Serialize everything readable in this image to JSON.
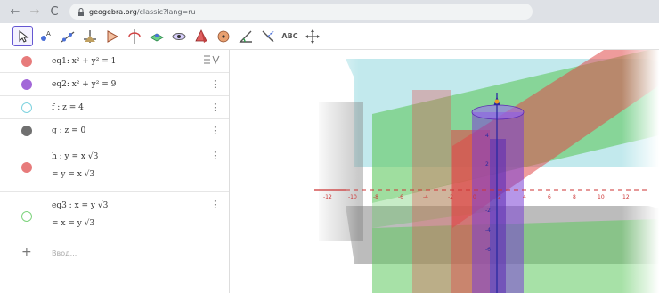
{
  "browser": {
    "url_host": "geogebra.org",
    "url_path": "/classic?lang=ru"
  },
  "algebra": {
    "rows": [
      {
        "color": "#e77b7b",
        "text": "eq1: x² + y² = 1"
      },
      {
        "color": "#a267d8",
        "text": "eq2: x² + y² = 9"
      },
      {
        "color": "#7fd3df",
        "text": "f : z = 4"
      },
      {
        "color": "#707070",
        "text": "g : z = 0"
      },
      {
        "color": "#e77b7b",
        "text": "h : y = x √3",
        "value": "= y = x √3"
      },
      {
        "color": "#7dd37d",
        "text": "eq3 : x = y √3",
        "value": "= x = y √3"
      }
    ],
    "input_placeholder": "Ввод..."
  },
  "axes": {
    "y_ticks": [
      "-12",
      "-10",
      "-8",
      "-6",
      "-4",
      "-2",
      "0",
      "2",
      "4",
      "6",
      "8",
      "10",
      "12"
    ],
    "z_ticks": [
      "4",
      "2",
      "-2",
      "-4",
      "-6"
    ]
  },
  "colors": {
    "accent": "#6557d2",
    "plane_red": "#e04848",
    "plane_green": "#5fc85f",
    "plane_cyan": "#8fd7df",
    "plane_gray": "#7a7a7a",
    "cylinder": "#7a3fd6"
  }
}
